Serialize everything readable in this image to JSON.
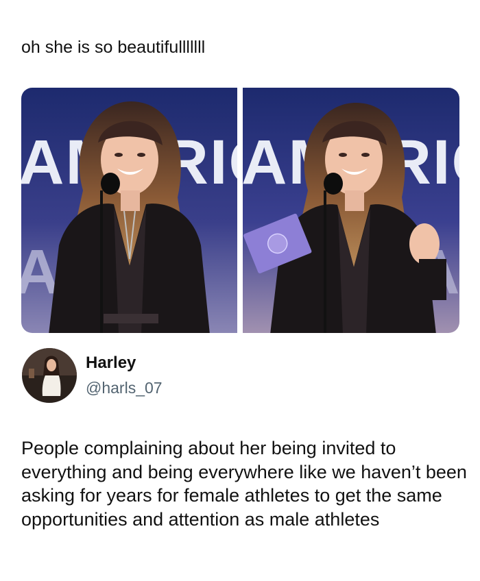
{
  "top_post": {
    "text": "oh she is so beautifulllllll"
  },
  "media": {
    "left_image": {
      "backdrop_text": "AMERIC"
    },
    "right_image": {
      "backdrop_text": "AMERICA"
    }
  },
  "quoted_tweet": {
    "author": {
      "name": "Harley",
      "handle": "@harls_07"
    },
    "text": "People complaining about her being invited to everything and being everywhere like we haven’t been asking for years for female athletes to get the same opportunities and attention as male athletes"
  }
}
